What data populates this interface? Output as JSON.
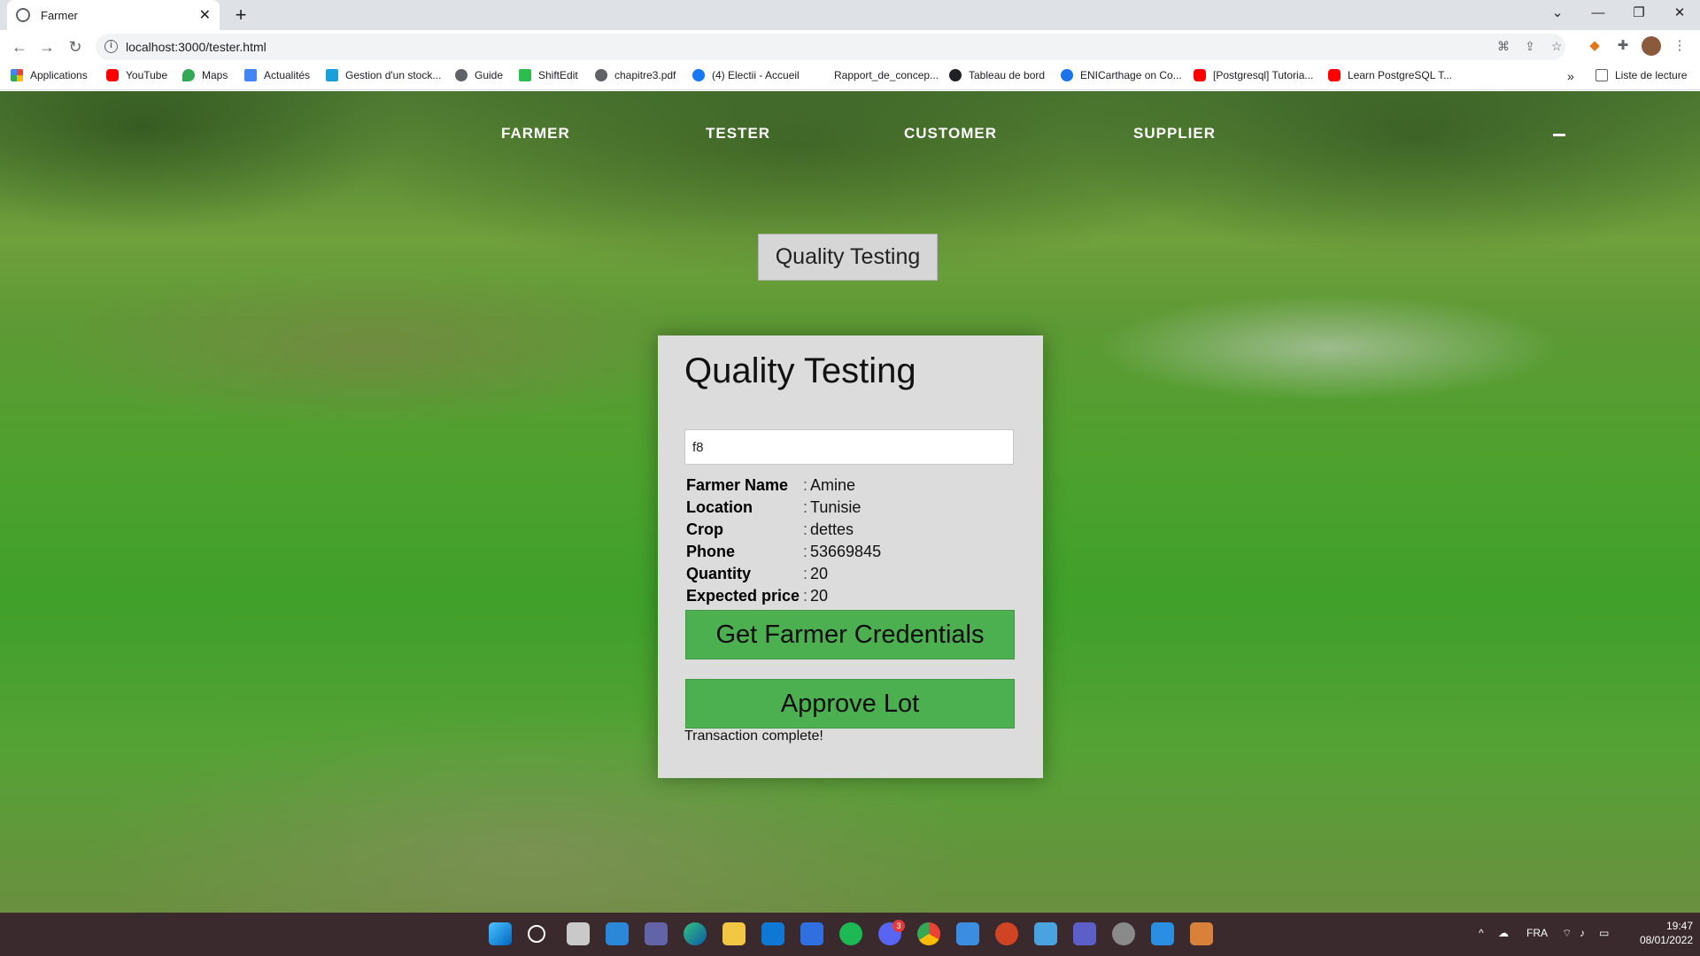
{
  "browser": {
    "tab_title": "Farmer",
    "url": "localhost:3000/tester.html",
    "bookmarks": [
      "Applications",
      "YouTube",
      "Maps",
      "Actualités",
      "Gestion d'un stock...",
      "Guide",
      "ShiftEdit",
      "chapitre3.pdf",
      "(4) Electii - Accueil",
      "Rapport_de_concep...",
      "Tableau de bord",
      "ENICarthage on Co...",
      "[Postgresql] Tutoria...",
      "Learn PostgreSQL T..."
    ],
    "reading_list": "Liste de lecture"
  },
  "nav": {
    "farmer": "FARMER",
    "tester": "TESTER",
    "customer": "CUSTOMER",
    "supplier": "SUPPLIER"
  },
  "hero_button": "Quality Testing",
  "card": {
    "title": "Quality Testing",
    "input_value": "f8",
    "details": [
      {
        "label": "Farmer Name",
        "value": "Amine"
      },
      {
        "label": "Location",
        "value": "Tunisie"
      },
      {
        "label": "Crop",
        "value": "dettes"
      },
      {
        "label": "Phone",
        "value": "53669845"
      },
      {
        "label": "Quantity",
        "value": "20"
      },
      {
        "label": "Expected price",
        "value": "20"
      }
    ],
    "separator": ":",
    "get_credentials_label": "Get Farmer Credentials",
    "approve_label": "Approve Lot",
    "status": "Transaction complete!"
  },
  "taskbar": {
    "language": "FRA",
    "time": "19:47",
    "date": "08/01/2022",
    "discord_badge": "3"
  },
  "colors": {
    "button_green": "#4caf50",
    "card_bg": "#dcdcdc",
    "taskbar": "#3a2a2e"
  }
}
